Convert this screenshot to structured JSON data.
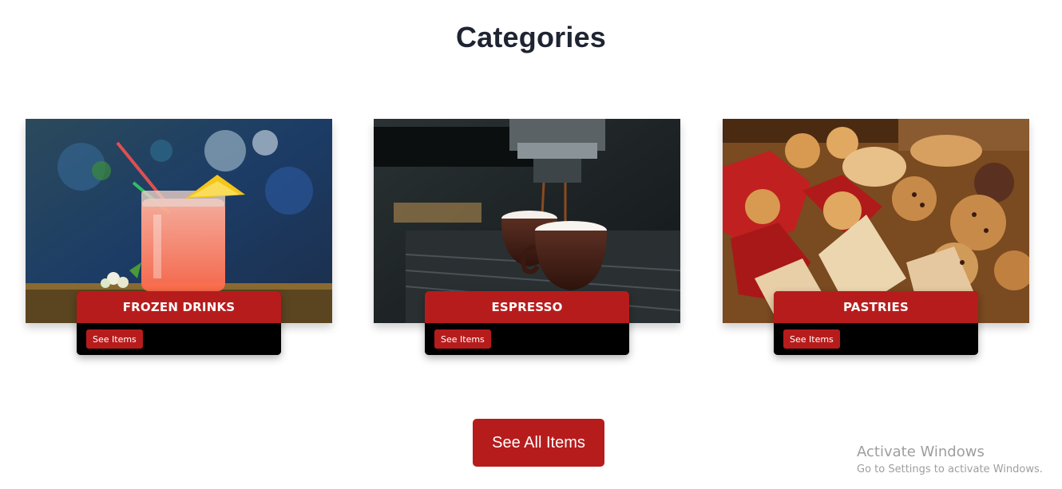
{
  "section": {
    "title": "Categories"
  },
  "categories": [
    {
      "name": "FROZEN DRINKS",
      "button_label": "See Items",
      "image": "iced-drink-photo"
    },
    {
      "name": "ESPRESSO",
      "button_label": "See Items",
      "image": "espresso-machine-photo"
    },
    {
      "name": "PASTRIES",
      "button_label": "See Items",
      "image": "pastries-photo"
    }
  ],
  "see_all_label": "See All Items",
  "watermark": {
    "title": "Activate Windows",
    "subtitle": "Go to Settings to activate Windows."
  },
  "colors": {
    "accent": "#b71c1c",
    "heading": "#1f2433",
    "card_footer": "#000000"
  }
}
